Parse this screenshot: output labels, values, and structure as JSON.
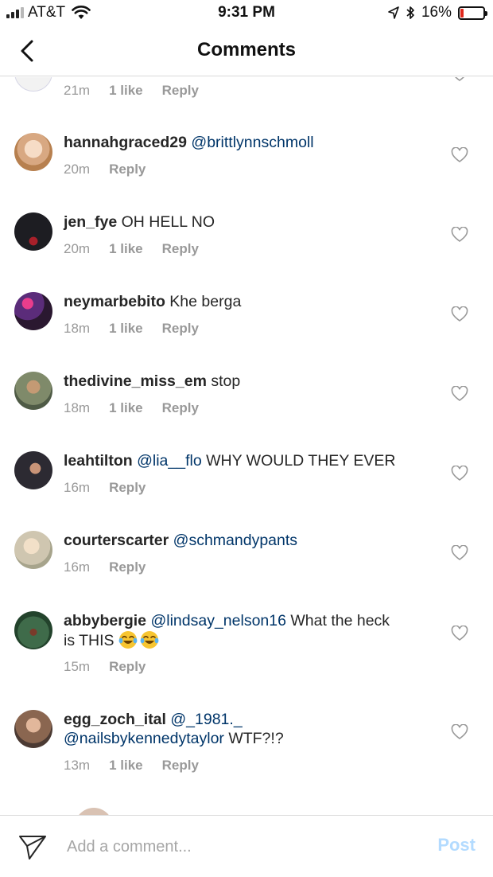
{
  "status_bar": {
    "carrier": "AT&T",
    "time": "9:31 PM",
    "battery_percent": "16%",
    "battery_level": 0.16,
    "battery_color": "#e0281c"
  },
  "nav": {
    "title": "Comments",
    "back_icon": "chevron-left-icon"
  },
  "partial_top_comment": {
    "time": "21m",
    "likes": "1 like",
    "reply": "Reply"
  },
  "comments": [
    {
      "username": "hannahgraced29",
      "mention": "@brittlynnschmoll",
      "text": "",
      "time": "20m",
      "likes": "",
      "reply": "Reply"
    },
    {
      "username": "jen_fye",
      "mention": "",
      "text": "OH HELL NO",
      "time": "20m",
      "likes": "1 like",
      "reply": "Reply"
    },
    {
      "username": "neymarbebito",
      "mention": "",
      "text": "Khe berga",
      "time": "18m",
      "likes": "1 like",
      "reply": "Reply"
    },
    {
      "username": "thedivine_miss_em",
      "mention": "",
      "text": "stop",
      "time": "18m",
      "likes": "1 like",
      "reply": "Reply"
    },
    {
      "username": "leahtilton",
      "mention": "@lia__flo",
      "text": "WHY WOULD THEY EVER",
      "time": "16m",
      "likes": "",
      "reply": "Reply"
    },
    {
      "username": "courterscarter",
      "mention": "@schmandypants",
      "text": "",
      "time": "16m",
      "likes": "",
      "reply": "Reply"
    },
    {
      "username": "abbybergie",
      "mention": "@lindsay_nelson16",
      "text": "What the heck",
      "text_line2": "is THIS",
      "time": "15m",
      "likes": "",
      "reply": "Reply"
    },
    {
      "username": "egg_zoch_ital",
      "mention": "@_1981._",
      "mention_line2": "@nailsbykennedytaylor",
      "text": "WTF?!?",
      "time": "13m",
      "likes": "1 like",
      "reply": "Reply"
    }
  ],
  "composer": {
    "placeholder": "Add a comment...",
    "post_label": "Post",
    "post_color": "#b3dbff"
  },
  "colors": {
    "mention": "#003569",
    "meta": "#999999",
    "text": "#262626"
  }
}
